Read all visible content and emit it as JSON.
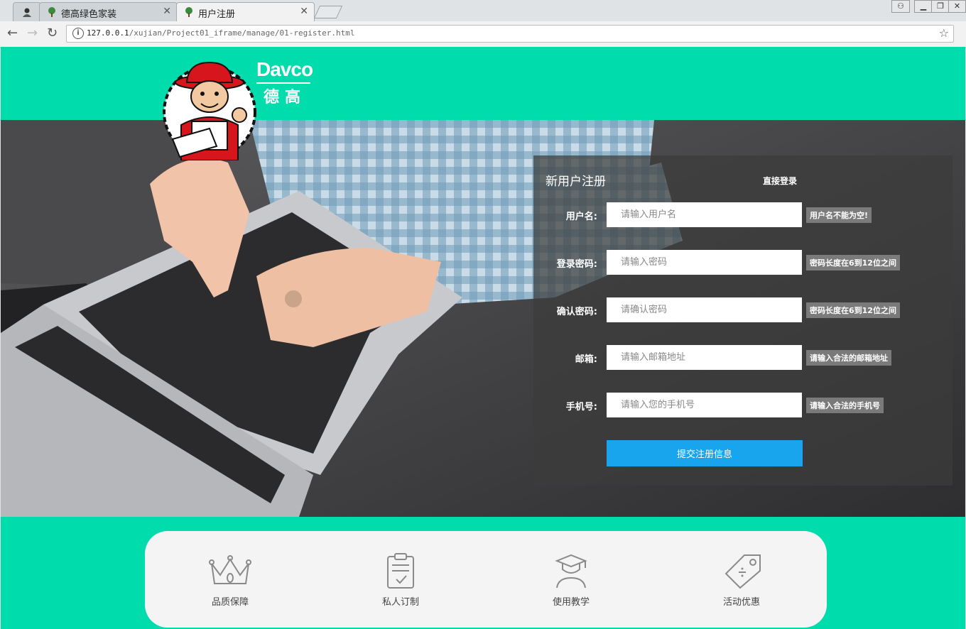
{
  "browser": {
    "tabs": [
      {
        "label": "",
        "icon": "avatar-icon"
      },
      {
        "label": "德高绿色家装",
        "icon": "tree-icon"
      },
      {
        "label": "用户注册",
        "icon": "tree-icon"
      }
    ],
    "url_host": "127.0.0.1",
    "url_path": "/xujian/Project01_iframe/manage/01-register.html"
  },
  "header": {
    "brand_en": "Davco",
    "brand_cn": "德高",
    "bg_color": "#00dcab"
  },
  "form": {
    "title": "新用户注册",
    "login_link": "直接登录",
    "fields": [
      {
        "label": "用户名:",
        "placeholder": "请输入用户名",
        "hint": "用户名不能为空!"
      },
      {
        "label": "登录密码:",
        "placeholder": "请输入密码",
        "hint": "密码长度在6到12位之间"
      },
      {
        "label": "确认密码:",
        "placeholder": "请确认密码",
        "hint": "密码长度在6到12位之间"
      },
      {
        "label": "邮箱:",
        "placeholder": "请输入邮箱地址",
        "hint": "请输入合法的邮箱地址"
      },
      {
        "label": "手机号:",
        "placeholder": "请输入您的手机号",
        "hint": "请输入合法的手机号"
      }
    ],
    "submit_label": "提交注册信息",
    "submit_color": "#19a4ee"
  },
  "features": [
    {
      "label": "品质保障",
      "icon": "crown-icon"
    },
    {
      "label": "私人订制",
      "icon": "clipboard-icon"
    },
    {
      "label": "使用教学",
      "icon": "graduate-icon"
    },
    {
      "label": "活动优惠",
      "icon": "price-tag-icon"
    }
  ]
}
